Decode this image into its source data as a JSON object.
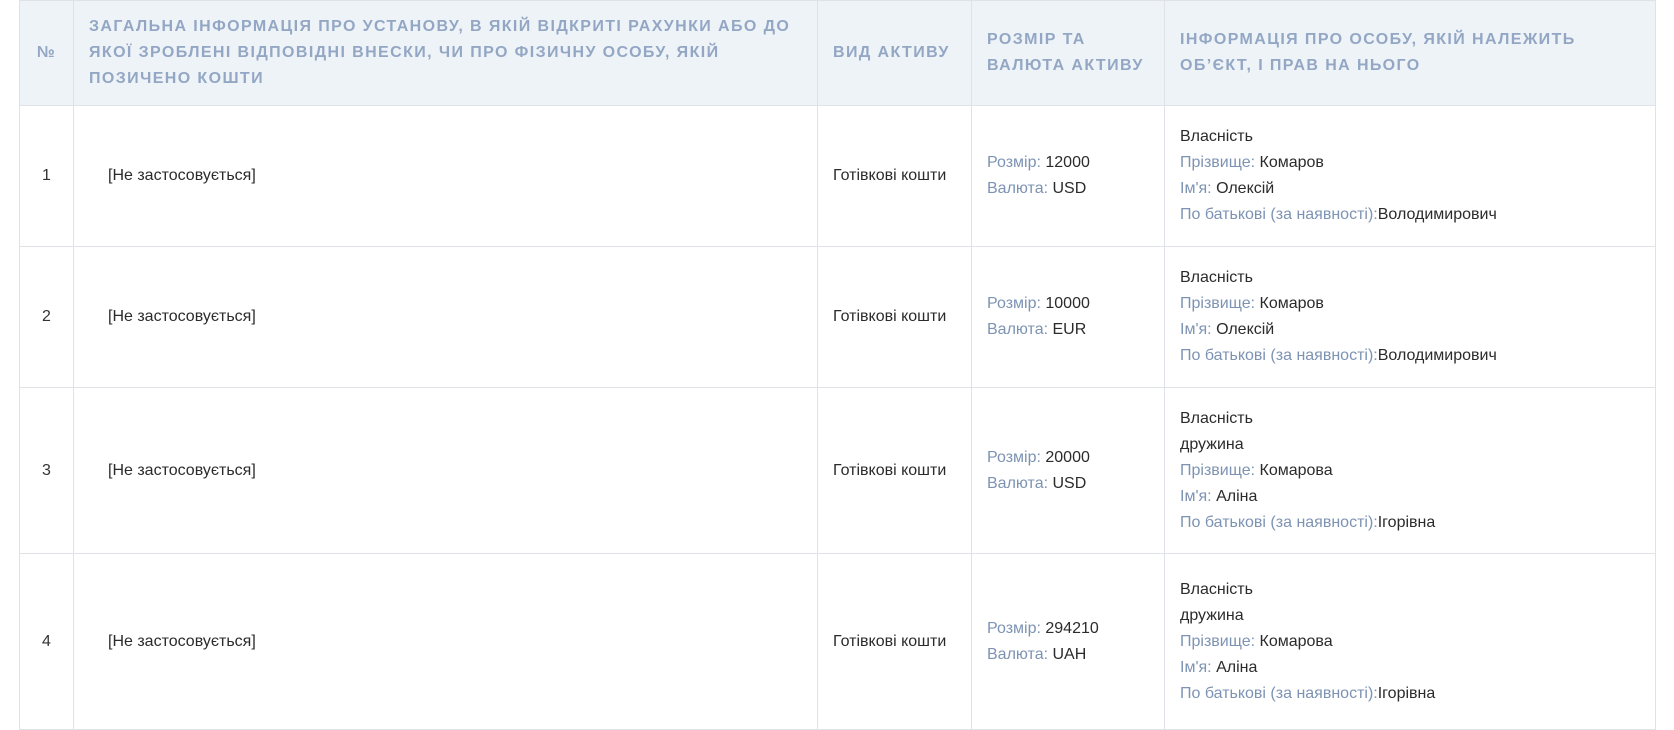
{
  "table": {
    "headers": {
      "num": "№",
      "institution": "Загальна інформація про установу, в якій відкриті рахунки або до якої зроблені відповідні внески, чи про фізичну особу, якій позичено кошти",
      "asset_type": "Вид активу",
      "amount_currency": "Розмір та валюта активу",
      "owner_info": "Інформація про особу, якій належить об’єкт, і прав на нього"
    },
    "labels": {
      "amount": "Розмір:",
      "currency": "Валюта:",
      "surname": "Прізвище:",
      "name": "Ім'я:",
      "patronymic": "По батькові (за наявності):"
    },
    "rows": [
      {
        "num": "1",
        "institution": "[Не застосовується]",
        "asset_type": "Готівкові кошти",
        "amount": "12000",
        "currency": "USD",
        "right": "Власність",
        "relation": "",
        "surname": "Комаров",
        "name": "Олексій",
        "patronymic": "Володимирович"
      },
      {
        "num": "2",
        "institution": "[Не застосовується]",
        "asset_type": "Готівкові кошти",
        "amount": "10000",
        "currency": "EUR",
        "right": "Власність",
        "relation": "",
        "surname": "Комаров",
        "name": "Олексій",
        "patronymic": "Володимирович"
      },
      {
        "num": "3",
        "institution": "[Не застосовується]",
        "asset_type": "Готівкові кошти",
        "amount": "20000",
        "currency": "USD",
        "right": "Власність",
        "relation": "дружина",
        "surname": "Комарова",
        "name": "Аліна",
        "patronymic": "Ігорівна"
      },
      {
        "num": "4",
        "institution": "[Не застосовується]",
        "asset_type": "Готівкові кошти",
        "amount": "294210",
        "currency": "UAH",
        "right": "Власність",
        "relation": "дружина",
        "surname": "Комарова",
        "name": "Аліна",
        "patronymic": "Ігорівна"
      }
    ]
  },
  "colors": {
    "header_bg": "#eef3f8",
    "header_text": "#93a7c4",
    "label_text": "#7d93b3",
    "border": "#dfe3e8"
  }
}
